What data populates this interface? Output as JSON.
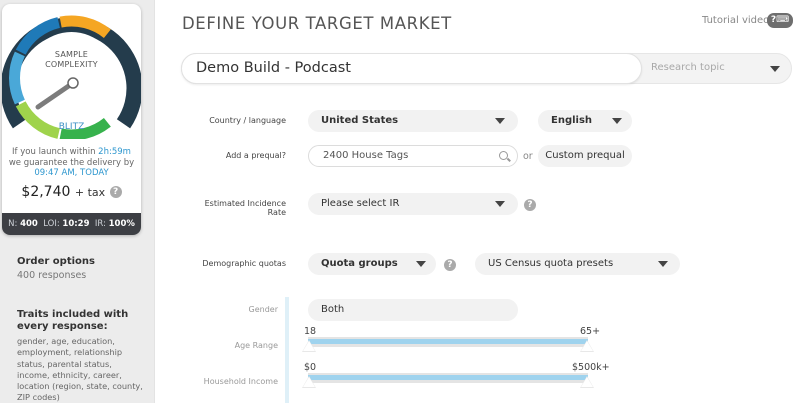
{
  "sidebar": {
    "gauge": {
      "label_line1": "SAMPLE",
      "label_line2": "COMPLEXITY",
      "level": "BLITZ",
      "segment_colors": [
        "#37b24d",
        "#9fd34c",
        "#4aa8d8",
        "#1f7ab8",
        "#f5a623"
      ]
    },
    "delivery": {
      "prefix": "If you launch within ",
      "countdown": "2h:59m",
      "middle": "we guarantee the delivery by",
      "deadline": "09:47 AM, TODAY"
    },
    "price": {
      "amount": "$2,740",
      "tax": "+ tax"
    },
    "stats": {
      "n_label": "N:",
      "n_value": "400",
      "loi_label": "LOI:",
      "loi_value": "10:29",
      "ir_label": "IR:",
      "ir_value": "100%"
    },
    "order_options": {
      "title": "Order options",
      "subtitle": "400 responses"
    },
    "traits": {
      "title": "Traits included with every response:",
      "text": "gender, age, education, employment, relationship status, parental status, income, ethnicity, career, location (region, state, county, ZIP codes)"
    }
  },
  "header": {
    "title": "DEFINE YOUR TARGET MARKET",
    "tutorial_label": "Tutorial video",
    "tutorial_icon": "tutorial-video-icon"
  },
  "study": {
    "title_value": "Demo Build - Podcast",
    "topic_placeholder": "Research topic"
  },
  "form": {
    "country": {
      "label": "Country / language",
      "value": "United States",
      "language": "English"
    },
    "prequal": {
      "label": "Add a prequal?",
      "value": "2400 House Tags",
      "or": "or",
      "custom_button": "Custom prequal"
    },
    "incidence": {
      "label": "Estimated Incidence Rate",
      "value": "Please select IR"
    },
    "quotas": {
      "label": "Demographic quotas",
      "quota_groups": "Quota groups",
      "preset": "US Census quota presets"
    },
    "gender": {
      "label": "Gender",
      "value": "Both"
    },
    "age": {
      "label": "Age Range",
      "min": "18",
      "max": "65+"
    },
    "income": {
      "label": "Household Income",
      "min": "$0",
      "max": "$500k+"
    }
  },
  "help_icon_glyph": "?"
}
